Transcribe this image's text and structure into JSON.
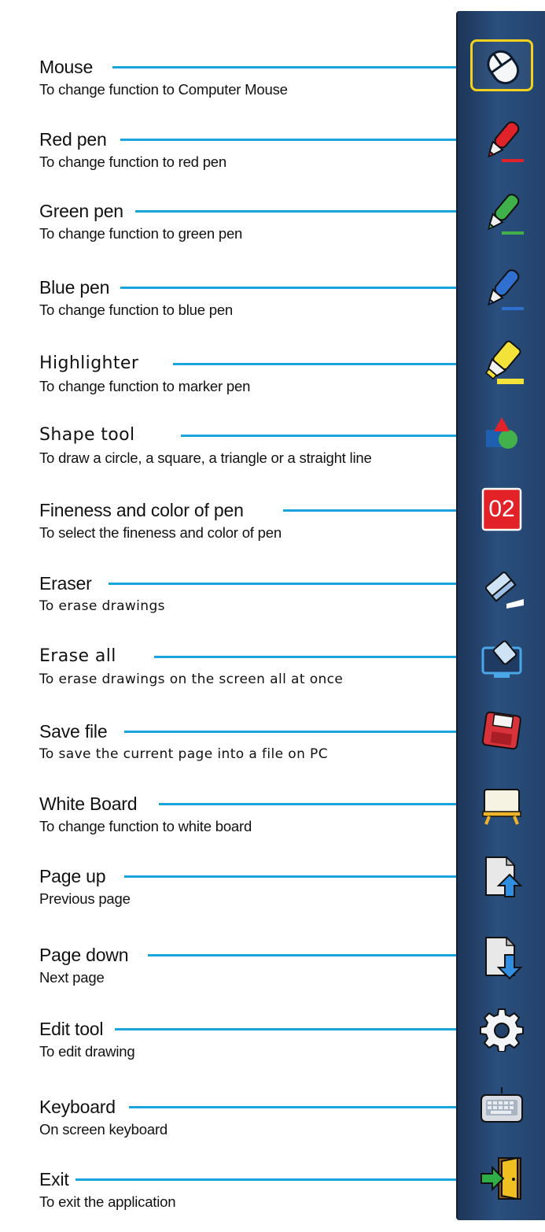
{
  "colors": {
    "leader_line": "#1aa3dd",
    "toolbar_bg": "#23426b",
    "active_border": "#f2d21e"
  },
  "page_badge": "02",
  "items": [
    {
      "title": "Mouse",
      "desc": "To change function to Computer Mouse",
      "icon": "mouse-icon"
    },
    {
      "title": "Red pen",
      "desc": "To change function to red pen",
      "icon": "red-pen-icon"
    },
    {
      "title": "Green pen",
      "desc": "To change function to green pen",
      "icon": "green-pen-icon"
    },
    {
      "title": "Blue pen",
      "desc": "To change function to blue pen",
      "icon": "blue-pen-icon"
    },
    {
      "title": "Highlighter",
      "desc": "To change function to marker pen",
      "icon": "highlighter-icon"
    },
    {
      "title": "Shape tool",
      "desc": "To draw a circle, a square, a triangle or a straight line",
      "icon": "shapes-icon"
    },
    {
      "title": "Fineness and color of pen",
      "desc": "To select the fineness and color of pen",
      "icon": "pen-size-icon"
    },
    {
      "title": "Eraser",
      "desc": "To erase drawings",
      "icon": "eraser-icon"
    },
    {
      "title": "Erase all",
      "desc": "To erase drawings on the screen all at once",
      "icon": "erase-all-icon"
    },
    {
      "title": "Save file",
      "desc": "To save the current page into a file on PC",
      "icon": "floppy-disk-icon"
    },
    {
      "title": "White Board",
      "desc": "To change function to white board",
      "icon": "whiteboard-icon"
    },
    {
      "title": "Page up",
      "desc": "Previous page",
      "icon": "page-up-icon"
    },
    {
      "title": "Page down",
      "desc": "Next page",
      "icon": "page-down-icon"
    },
    {
      "title": "Edit tool",
      "desc": "To edit drawing",
      "icon": "gear-icon"
    },
    {
      "title": "Keyboard",
      "desc": "On screen keyboard",
      "icon": "keyboard-icon"
    },
    {
      "title": "Exit",
      "desc": "To exit the application",
      "icon": "exit-door-icon"
    }
  ]
}
